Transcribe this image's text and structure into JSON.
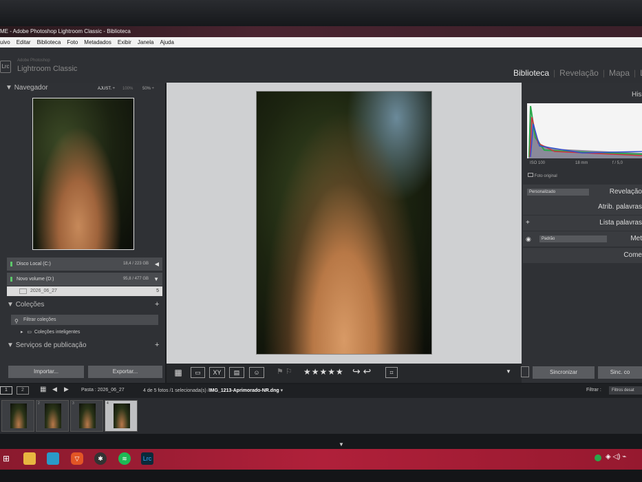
{
  "window": {
    "title": "ME - Adobe Photoshop Lightroom Classic - Biblioteca",
    "menu": [
      "uivo",
      "Editar",
      "Biblioteca",
      "Foto",
      "Metadados",
      "Exibir",
      "Janela",
      "Ajuda"
    ]
  },
  "brand": {
    "badge": "Lrc",
    "sub": "Adobe Photoshop",
    "name": "Lightroom Classic"
  },
  "modules": {
    "active": "Biblioteca",
    "second": "Revelação",
    "third": "Mapa",
    "fourth": "L"
  },
  "navigator": {
    "title": "Navegador",
    "fit": "AJUST. ÷",
    "zoom1": "100%",
    "zoom2": "50% ÷"
  },
  "volumes": [
    {
      "name": "Disco Local (C:)",
      "size": "18,4 / 223 GB",
      "arrow": "◀"
    },
    {
      "name": "Novo volume (D:)",
      "size": "95,8 / 477 GB",
      "arrow": "▼"
    }
  ],
  "folder": {
    "name": "2026_06_27",
    "count": "5"
  },
  "collections": {
    "title": "Coleções",
    "filter": "Filtrar coleções",
    "smart": "Coleções inteligentes"
  },
  "publish": {
    "title": "Serviços de publicação"
  },
  "buttons": {
    "import": "Importar...",
    "export": "Exportar..."
  },
  "toolbar": {
    "stars": "★★★★★"
  },
  "right": {
    "histogram_label": "His",
    "iso": "ISO 100",
    "focal": "18 mm",
    "aperture": "f / 5,0",
    "original_photo": "Foto original",
    "preset": "Personalizado",
    "quick_develop": "Revelação",
    "keywording": "Atrib. palavras",
    "keyword_list": "Lista palavras",
    "metadata_preset": "Padrão",
    "metadata": "Met",
    "comments": "Come",
    "sync": "Sincronizar",
    "sync2": "Sinc. co"
  },
  "filmstrip": {
    "folder": "Pasta : 2026_06_27",
    "info": "4 de 5 fotos /1 selecionada(s) /",
    "file": "IMG_1213-Aprimorado-NR.dng",
    "filter_label": "Filtrar :",
    "filter_value": "Filtros desat",
    "page1": "1",
    "page2": "2",
    "thumb_badges": [
      "",
      "2",
      "3",
      "4"
    ]
  },
  "colors": {
    "taskbar": "#b0203a",
    "panel": "#2f3135",
    "center": "#cfd0d2"
  }
}
